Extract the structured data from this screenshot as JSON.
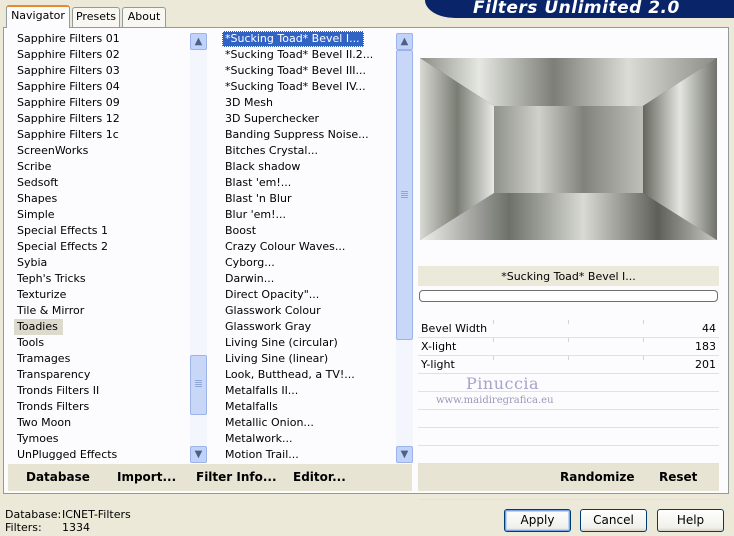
{
  "tabs": [
    {
      "label": "Navigator",
      "active": true
    },
    {
      "label": "Presets",
      "active": false
    },
    {
      "label": "About",
      "active": false
    }
  ],
  "title": "Filters Unlimited 2.0",
  "categories": {
    "items": [
      "Sapphire Filters 01",
      "Sapphire Filters 02",
      "Sapphire Filters 03",
      "Sapphire Filters 04",
      "Sapphire Filters 09",
      "Sapphire Filters 12",
      "Sapphire Filters 1c",
      "ScreenWorks",
      "Scribe",
      "Sedsoft",
      "Shapes",
      "Simple",
      "Special Effects 1",
      "Special Effects 2",
      "Sybia",
      "Teph's Tricks",
      "Texturize",
      "Tile & Mirror",
      "Toadies",
      "Tools",
      "Tramages",
      "Transparency",
      "Tronds Filters II",
      "Tronds Filters",
      "Two Moon",
      "Tymoes",
      "UnPlugged Effects"
    ],
    "highlighted": "Toadies"
  },
  "filters": {
    "items": [
      "*Sucking Toad*  Bevel I...",
      "*Sucking Toad*  Bevel II.2...",
      "*Sucking Toad*  Bevel III...",
      "*Sucking Toad*  Bevel IV...",
      "3D Mesh",
      "3D Superchecker",
      "Banding Suppress Noise...",
      "Bitches Crystal...",
      "Black shadow",
      "Blast 'em!...",
      "Blast 'n Blur",
      "Blur 'em!...",
      "Boost",
      "Crazy Colour Waves...",
      "Cyborg...",
      "Darwin...",
      "Direct Opacity\"...",
      "Glasswork Colour",
      "Glasswork Gray",
      "Living Sine (circular)",
      "Living Sine (linear)",
      "Look, Butthead, a TV!...",
      "Metalfalls II...",
      "Metalfalls",
      "Metallic Onion...",
      "Metalwork...",
      "Motion Trail..."
    ],
    "selected": "*Sucking Toad*  Bevel I..."
  },
  "left_buttons": {
    "database": "Database",
    "import": "Import...",
    "filter_info": "Filter Info...",
    "editor": "Editor..."
  },
  "preview": {
    "filter_name": "*Sucking Toad*  Bevel I...",
    "progress": 0
  },
  "params": [
    {
      "label": "Bevel Width",
      "value": "44"
    },
    {
      "label": "X-light",
      "value": "183"
    },
    {
      "label": "Y-light",
      "value": "201"
    }
  ],
  "watermark": {
    "name": "Pinuccia",
    "url": "www.maidiregrafica.eu"
  },
  "right_buttons": {
    "randomize": "Randomize",
    "reset": "Reset"
  },
  "status": {
    "database_label": "Database:",
    "database_value": "ICNET-Filters",
    "filters_label": "Filters:",
    "filters_value": "1334"
  },
  "dialog_buttons": {
    "apply": "Apply",
    "cancel": "Cancel",
    "help": "Help"
  },
  "colors": {
    "selection": "#3163c5",
    "title_bar": "#0a246a",
    "highlight": "#dcdacd"
  }
}
